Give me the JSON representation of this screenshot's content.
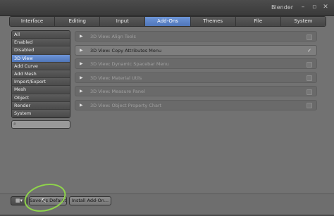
{
  "window": {
    "title": "Blender",
    "controls": [
      "–",
      "▫",
      "✕"
    ]
  },
  "tabs": [
    {
      "label": "Interface",
      "active": false
    },
    {
      "label": "Editing",
      "active": false
    },
    {
      "label": "Input",
      "active": false
    },
    {
      "label": "Add-Ons",
      "active": true
    },
    {
      "label": "Themes",
      "active": false
    },
    {
      "label": "File",
      "active": false
    },
    {
      "label": "System",
      "active": false
    }
  ],
  "sidebar": {
    "items": [
      {
        "label": "All"
      },
      {
        "label": "Enabled"
      },
      {
        "label": "Disabled"
      },
      {
        "label": "3D View"
      },
      {
        "label": "Add Curve"
      },
      {
        "label": "Add Mesh"
      },
      {
        "label": "Import/Export"
      },
      {
        "label": "Mesh"
      },
      {
        "label": "Object"
      },
      {
        "label": "Render"
      },
      {
        "label": "System"
      }
    ],
    "active_index": 3,
    "search": {
      "icon": "magnifier-icon",
      "value": ""
    }
  },
  "addons": [
    {
      "label": "3D View: Align Tools",
      "enabled": false
    },
    {
      "label": "3D View: Copy Attributes Menu",
      "enabled": true
    },
    {
      "label": "3D View: Dynamic Spacebar Menu",
      "enabled": false
    },
    {
      "label": "3D View: Material Utils",
      "enabled": false
    },
    {
      "label": "3D View: Measure Panel",
      "enabled": false
    },
    {
      "label": "3D View: Object Property Chart",
      "enabled": false
    }
  ],
  "bottom": {
    "editor_type_icon": "editor-type-icon",
    "save_label": "Save As Default",
    "install_label": "Install Add-On..."
  },
  "colors": {
    "accent": "#5a82c6",
    "highlight_ring": "#8fd44b"
  }
}
